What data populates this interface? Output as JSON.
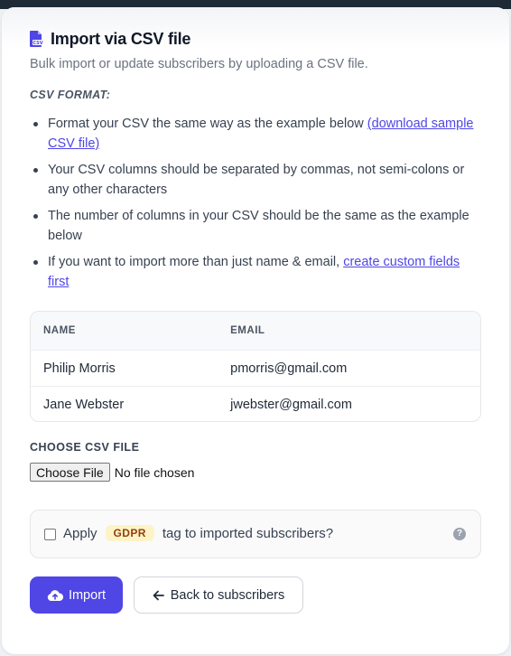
{
  "page": {
    "title": "Import via CSV file",
    "subtitle": "Bulk import or update subscribers by uploading a CSV file."
  },
  "format": {
    "label": "CSV FORMAT:",
    "rules": [
      {
        "text": "Format your CSV the same way as the example below ",
        "link": "(download sample CSV file)"
      },
      {
        "text": "Your CSV columns should be separated by commas, not semi-colons or any other characters"
      },
      {
        "text": "The number of columns in your CSV should be the same as the example below"
      },
      {
        "text": "If you want to import more than just name & email, ",
        "link": "create custom fields first"
      }
    ]
  },
  "example_table": {
    "headers": [
      "NAME",
      "EMAIL"
    ],
    "rows": [
      [
        "Philip Morris",
        "pmorris@gmail.com"
      ],
      [
        "Jane Webster",
        "jwebster@gmail.com"
      ]
    ]
  },
  "file_upload": {
    "label": "CHOOSE CSV FILE",
    "button_label": "Choose File",
    "status": "No file chosen"
  },
  "gdpr": {
    "checked": false,
    "before_text": "Apply",
    "badge": "GDPR",
    "after_text": "tag to imported subscribers?",
    "help_icon": "question-icon"
  },
  "actions": {
    "import_label": "Import",
    "import_icon": "cloud-upload-icon",
    "back_label": "Back to subscribers",
    "back_icon": "arrow-left-icon"
  },
  "colors": {
    "accent": "#4f46e5",
    "badge_bg": "#fef3c7",
    "badge_text": "#92400e"
  }
}
